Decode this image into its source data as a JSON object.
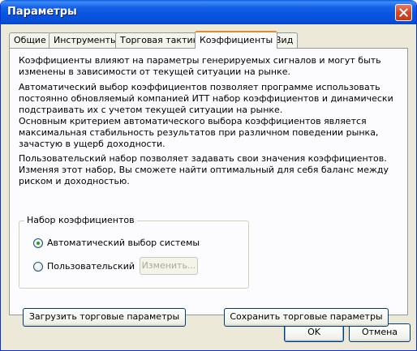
{
  "window": {
    "title": "Параметры"
  },
  "tabs": [
    {
      "label": "Общие"
    },
    {
      "label": "Инструменты"
    },
    {
      "label": "Торговая тактика"
    },
    {
      "label": "Коэффициенты",
      "active": true
    },
    {
      "label": "Вид"
    }
  ],
  "panel": {
    "paragraph1": "Коэффициенты влияют на параметры генерируемых сигналов и могут быть изменены в зависимости от текущей ситуации на рынке.",
    "paragraph2": "Автоматический выбор коэффициентов позволяет программе использовать постоянно обновляемый компанией ИТТ набор коэффициентов и динамически подстраивать их с учетом текущей ситуации на рынке.",
    "paragraph3": "Основным критерием автоматического выбора коэффициентов является максимальная стабильность результатов при различном поведении рынка, зачастую в ущерб доходности.",
    "paragraph4": "Пользовательский набор позволяет задавать свои значения коэффициентов. Изменяя этот набор, Вы сможете найти оптимальный для себя баланс между риском и доходностью."
  },
  "group": {
    "title": "Набор коэффициентов",
    "auto_label": "Автоматический выбор системы",
    "custom_label": "Пользовательский",
    "edit_button": "Изменить...",
    "selected": "auto"
  },
  "actions": {
    "load_button": "Загрузить торговые параметры",
    "save_button": "Сохранить торговые параметры"
  },
  "footer": {
    "ok_button": "OK",
    "cancel_button": "Отмена"
  }
}
